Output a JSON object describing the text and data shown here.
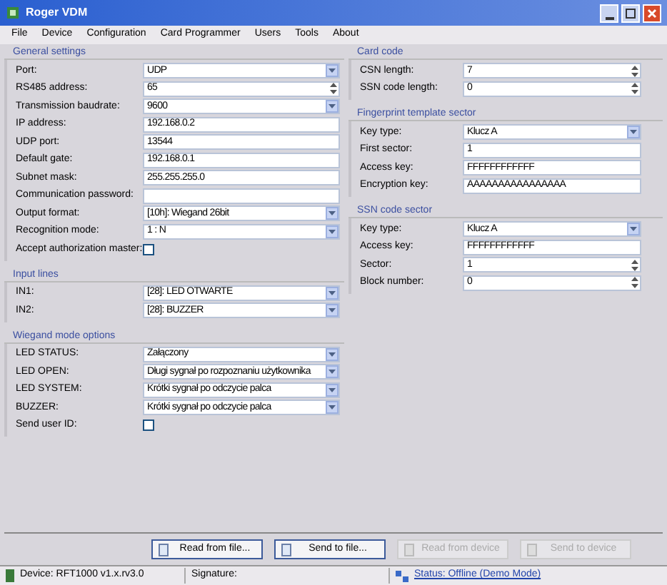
{
  "window": {
    "title": "Roger VDM"
  },
  "menu": [
    "File",
    "Device",
    "Configuration",
    "Card Programmer",
    "Users",
    "Tools",
    "About"
  ],
  "left_sections": [
    {
      "title": "General settings",
      "fields": [
        {
          "label": "Port:",
          "kind": "select",
          "value": "UDP"
        },
        {
          "label": "RS485 address:",
          "kind": "spin",
          "value": "65"
        },
        {
          "label": "Transmission baudrate:",
          "kind": "select",
          "value": "9600"
        },
        {
          "label": "IP address:",
          "kind": "text",
          "value": "192.168.0.2"
        },
        {
          "label": "UDP port:",
          "kind": "text",
          "value": "13544"
        },
        {
          "label": "Default gate:",
          "kind": "text",
          "value": "192.168.0.1"
        },
        {
          "label": "Subnet mask:",
          "kind": "text",
          "value": "255.255.255.0"
        },
        {
          "label": "Communication password:",
          "kind": "text"
        },
        {
          "label": "Output format:",
          "kind": "select",
          "value": "[10h]: Wiegand 26bit"
        },
        {
          "label": "Recognition mode:",
          "kind": "select",
          "value": "1 : N"
        },
        {
          "label": "Accept authorization master:",
          "kind": "checkbox",
          "checked": false
        }
      ]
    },
    {
      "title": "Input lines",
      "fields": [
        {
          "label": "IN1:",
          "kind": "select",
          "value": "[28]: LED OTWARTE"
        },
        {
          "label": "IN2:",
          "kind": "select",
          "value": "[28]: BUZZER"
        }
      ]
    },
    {
      "title": "Wiegand mode options",
      "fields": [
        {
          "label": "LED STATUS:",
          "kind": "select",
          "value": "Załączony"
        },
        {
          "label": "LED OPEN:",
          "kind": "select",
          "value": "Długi sygnał po rozpoznaniu użytkownika"
        },
        {
          "label": "LED SYSTEM:",
          "kind": "select",
          "value": "Krótki sygnał po odczycie palca"
        },
        {
          "label": "BUZZER:",
          "kind": "select",
          "value": "Krótki sygnał po odczycie palca"
        },
        {
          "label": "Send user ID:",
          "kind": "checkbox",
          "checked": false
        }
      ]
    }
  ],
  "right_sections": [
    {
      "title": "Card code",
      "fields": [
        {
          "label": "CSN length:",
          "kind": "spin",
          "value": "7"
        },
        {
          "label": "SSN code length:",
          "kind": "spin",
          "value": "0"
        }
      ]
    },
    {
      "title": "Fingerprint template sector",
      "fields": [
        {
          "label": "Key type:",
          "kind": "select",
          "value": "Klucz A"
        },
        {
          "label": "First sector:",
          "kind": "text",
          "value": "1"
        },
        {
          "label": "Access key:",
          "kind": "text",
          "value": "FFFFFFFFFFFF"
        },
        {
          "label": "Encryption key:",
          "kind": "text",
          "value": "AAAAAAAAAAAAAAAA"
        }
      ]
    },
    {
      "title": "SSN code sector",
      "fields": [
        {
          "label": "Key type:",
          "kind": "select",
          "value": "Klucz A"
        },
        {
          "label": "Access key:",
          "kind": "text",
          "value": "FFFFFFFFFFFF"
        },
        {
          "label": "Sector:",
          "kind": "spin",
          "value": "1"
        },
        {
          "label": "Block number:",
          "kind": "spin",
          "value": "0"
        }
      ]
    }
  ],
  "buttons": [
    {
      "label": "Read from file...",
      "disabled": false
    },
    {
      "label": "Send to file...",
      "disabled": false
    },
    {
      "label": "Read from device",
      "disabled": true
    },
    {
      "label": "Send to device",
      "disabled": true
    }
  ],
  "status_bar": {
    "device": "Device: RFT1000 v1.x.rv3.0",
    "signature": "Signature:",
    "status": "Status: Offline (Demo Mode)"
  }
}
